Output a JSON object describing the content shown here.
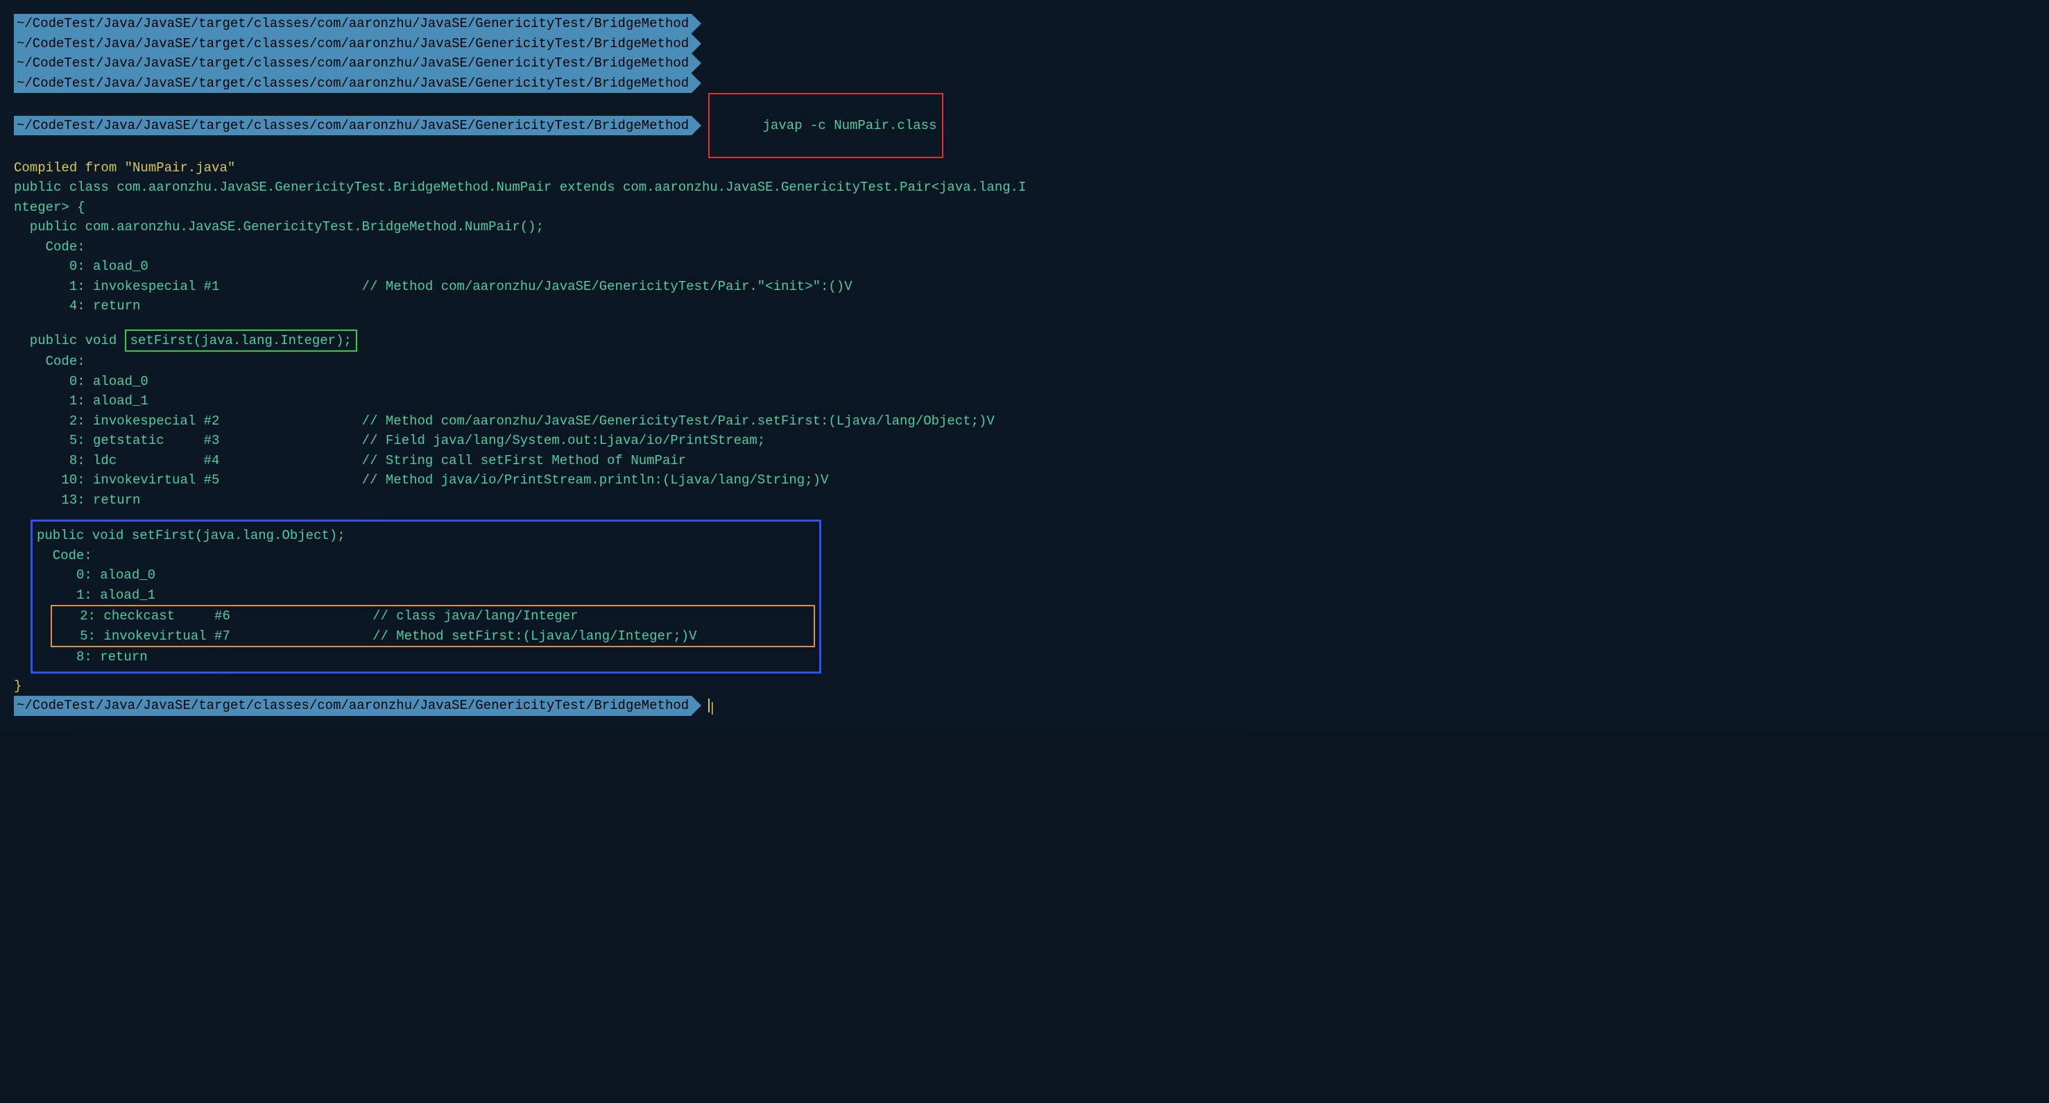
{
  "prompt_path": "~/CodeTest/Java/JavaSE/target/classes/com/aaronzhu/JavaSE/GenericityTest/BridgeMethod",
  "command": "javap -c NumPair.class",
  "output": {
    "compiled_from": "Compiled from \"NumPair.java\"",
    "class_decl": "public class com.aaronzhu.JavaSE.GenericityTest.BridgeMethod.NumPair extends com.aaronzhu.JavaSE.GenericityTest.Pair<java.lang.I",
    "class_decl2": "nteger> {",
    "constructor": {
      "sig": "  public com.aaronzhu.JavaSE.GenericityTest.BridgeMethod.NumPair();",
      "code_label": "    Code:",
      "line1": "       0: aload_0",
      "line2": "       1: invokespecial #1",
      "line2_comment": "                  // Method com/aaronzhu/JavaSE/GenericityTest/Pair.\"<init>\":()V",
      "line3": "       4: return"
    },
    "setFirst_int": {
      "prefix": "  public void ",
      "highlighted": "setFirst(java.lang.Integer);",
      "code_label": "    Code:",
      "line1": "       0: aload_0",
      "line2": "       1: aload_1",
      "line3": "       2: invokespecial #2",
      "line3_comment": "                  // Method com/aaronzhu/JavaSE/GenericityTest/Pair.setFirst:(Ljava/lang/Object;)V",
      "line4": "       5: getstatic     #3",
      "line4_comment": "                  // Field java/lang/System.out:Ljava/io/PrintStream;",
      "line5": "       8: ldc           #4",
      "line5_comment": "                  // String call setFirst Method of NumPair",
      "line6": "      10: invokevirtual #5",
      "line6_comment": "                  // Method java/io/PrintStream.println:(Ljava/lang/String;)V",
      "line7": "      13: return"
    },
    "setFirst_obj": {
      "sig": "public void setFirst(java.lang.Object);",
      "code_label": "  Code:",
      "line1": "     0: aload_0",
      "line2": "     1: aload_1",
      "line3": "   2: checkcast     #6",
      "line3_comment": "                  // class java/lang/Integer",
      "line4": "   5: invokevirtual #7",
      "line4_comment": "                  // Method setFirst:(Ljava/lang/Integer;)V",
      "line5": "     8: return"
    },
    "close_brace": "}"
  }
}
